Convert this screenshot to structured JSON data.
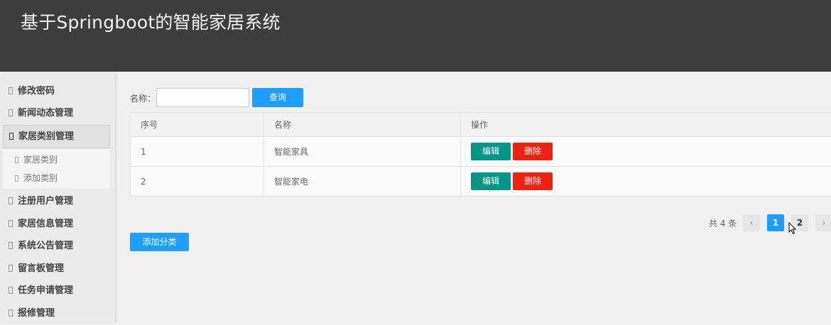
{
  "header": {
    "title": "基于Springboot的智能家居系统"
  },
  "sidebar": {
    "items": [
      {
        "label": "修改密码"
      },
      {
        "label": "新闻动态管理"
      },
      {
        "label": "家居类别管理",
        "active": true
      },
      {
        "label": "注册用户管理"
      },
      {
        "label": "家居信息管理"
      },
      {
        "label": "系统公告管理"
      },
      {
        "label": "留言板管理"
      },
      {
        "label": "任务申请管理"
      },
      {
        "label": "报修管理"
      }
    ],
    "subitems": [
      {
        "label": "家居类别"
      },
      {
        "label": "添加类别"
      }
    ]
  },
  "search": {
    "label": "名称：",
    "value": "",
    "placeholder": "",
    "button": "查询"
  },
  "table": {
    "columns": [
      "序号",
      "名称",
      "操作"
    ],
    "rows": [
      {
        "index": "1",
        "name": "智能家具"
      },
      {
        "index": "2",
        "name": "智能家电"
      }
    ],
    "edit_label": "编辑",
    "delete_label": "删除"
  },
  "pagination": {
    "total": "共 4 条",
    "prev": "‹",
    "pages": [
      "1",
      "2"
    ],
    "current": "1",
    "next": "›"
  },
  "add_button": "添加分类",
  "colors": {
    "header_bg": "#3d3d3d",
    "primary": "#1e9fff",
    "edit": "#009688",
    "delete": "#ee2211"
  },
  "icons": [
    "square-bullet-icon",
    "mouse-cursor-icon"
  ]
}
